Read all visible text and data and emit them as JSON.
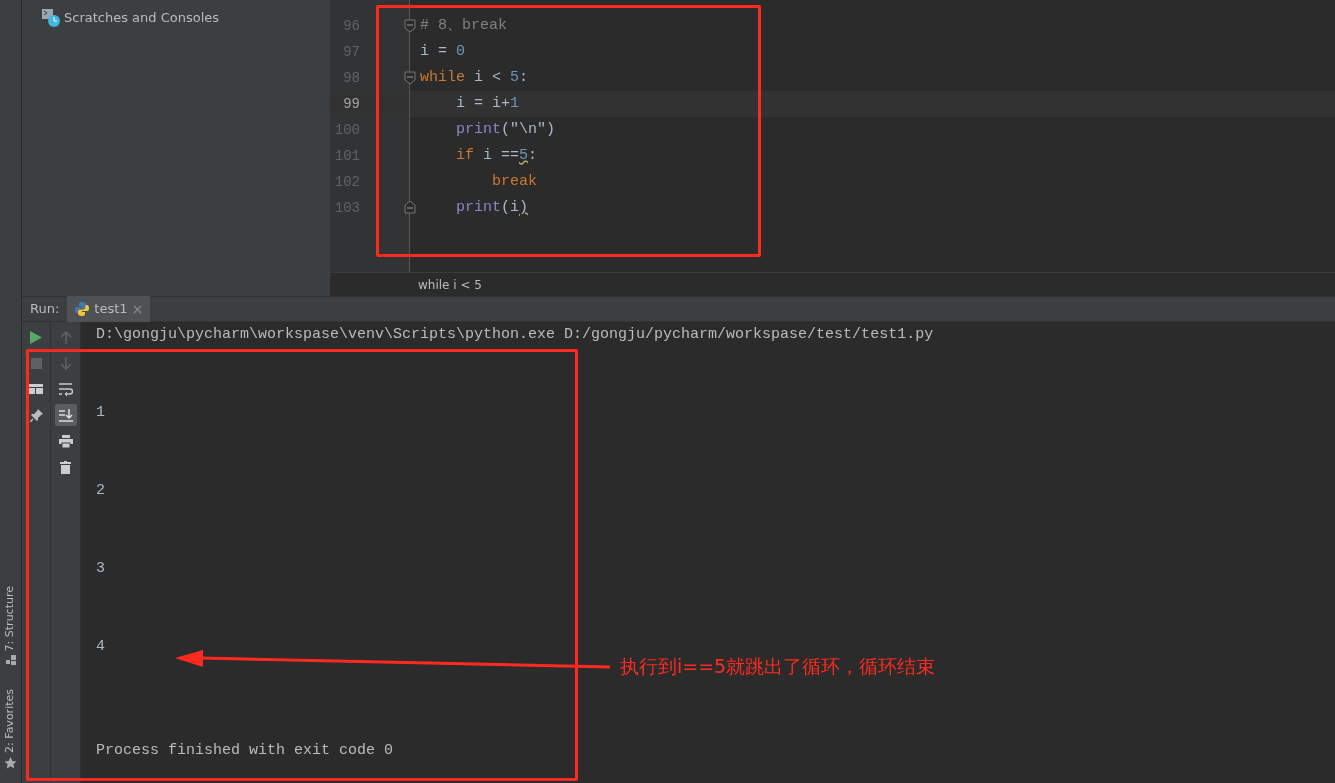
{
  "side_strip": {
    "tabs": [
      {
        "label": "7: Structure",
        "kind": "structure"
      },
      {
        "label": "2: Favorites",
        "kind": "favorites"
      }
    ]
  },
  "project_tree": {
    "items": [
      {
        "label": "Scratches and Consoles",
        "kind": "scratches"
      }
    ]
  },
  "editor": {
    "lines": [
      {
        "number": "96",
        "fold_start": true,
        "fold_end": false,
        "current": false,
        "tokens": [
          {
            "text": "# 8、break",
            "kind": "comment"
          }
        ]
      },
      {
        "number": "97",
        "fold_start": false,
        "fold_end": false,
        "current": false,
        "tokens": [
          {
            "text": "i = ",
            "kind": "plain"
          },
          {
            "text": "0",
            "kind": "number"
          }
        ]
      },
      {
        "number": "98",
        "fold_start": true,
        "fold_end": false,
        "current": false,
        "tokens": [
          {
            "text": "while",
            "kind": "keyword"
          },
          {
            "text": " i < ",
            "kind": "plain"
          },
          {
            "text": "5",
            "kind": "number"
          },
          {
            "text": ":",
            "kind": "plain"
          }
        ]
      },
      {
        "number": "99",
        "fold_start": false,
        "fold_end": false,
        "current": true,
        "tokens": [
          {
            "text": "    i = i+",
            "kind": "plain"
          },
          {
            "text": "1",
            "kind": "number"
          }
        ]
      },
      {
        "number": "100",
        "fold_start": false,
        "fold_end": false,
        "current": false,
        "tokens": [
          {
            "text": "    print",
            "kind": "builtin"
          },
          {
            "text": "(",
            "kind": "plain"
          },
          {
            "text": "\"\\n\"",
            "kind": "string"
          },
          {
            "text": ")",
            "kind": "plain"
          }
        ]
      },
      {
        "number": "101",
        "fold_start": false,
        "fold_end": false,
        "current": false,
        "tokens": [
          {
            "text": "    if",
            "kind": "keyword"
          },
          {
            "text": " i ==",
            "kind": "plain"
          },
          {
            "text": "5",
            "kind": "number",
            "warning": true
          },
          {
            "text": ":",
            "kind": "plain"
          }
        ]
      },
      {
        "number": "102",
        "fold_start": false,
        "fold_end": false,
        "current": false,
        "tokens": [
          {
            "text": "        break",
            "kind": "keyword"
          }
        ]
      },
      {
        "number": "103",
        "fold_start": false,
        "fold_end": true,
        "current": false,
        "tokens": [
          {
            "text": "    print",
            "kind": "builtin"
          },
          {
            "text": "(i",
            "kind": "plain"
          },
          {
            "text": ")",
            "kind": "plain",
            "warning": true
          }
        ]
      }
    ],
    "breadcrumb": "while i < 5"
  },
  "run": {
    "label": "Run:",
    "tabs": [
      {
        "label": "test1",
        "selected": true
      }
    ],
    "toolbar": [
      {
        "kind": "run",
        "toggled": false
      },
      {
        "kind": "stop",
        "toggled": false
      },
      {
        "kind": "layout",
        "toggled": false
      },
      {
        "kind": "pin",
        "toggled": false
      }
    ],
    "toolbar_2": [
      {
        "kind": "up",
        "toggled": false
      },
      {
        "kind": "down",
        "toggled": false
      },
      {
        "kind": "wrap",
        "toggled": false
      },
      {
        "kind": "scroll-end",
        "toggled": true
      },
      {
        "kind": "print",
        "toggled": false
      },
      {
        "kind": "trash",
        "toggled": false
      }
    ],
    "command": "D:\\gongju\\pycharm\\workspase\\venv\\Scripts\\python.exe D:/gongju/pycharm/workspase/test/test1.py",
    "output": [
      "1",
      "2",
      "3",
      "4"
    ],
    "exit_message": "Process finished with exit code 0"
  },
  "annotation": {
    "text": "执行到i==5就跳出了循环，循环结束"
  }
}
